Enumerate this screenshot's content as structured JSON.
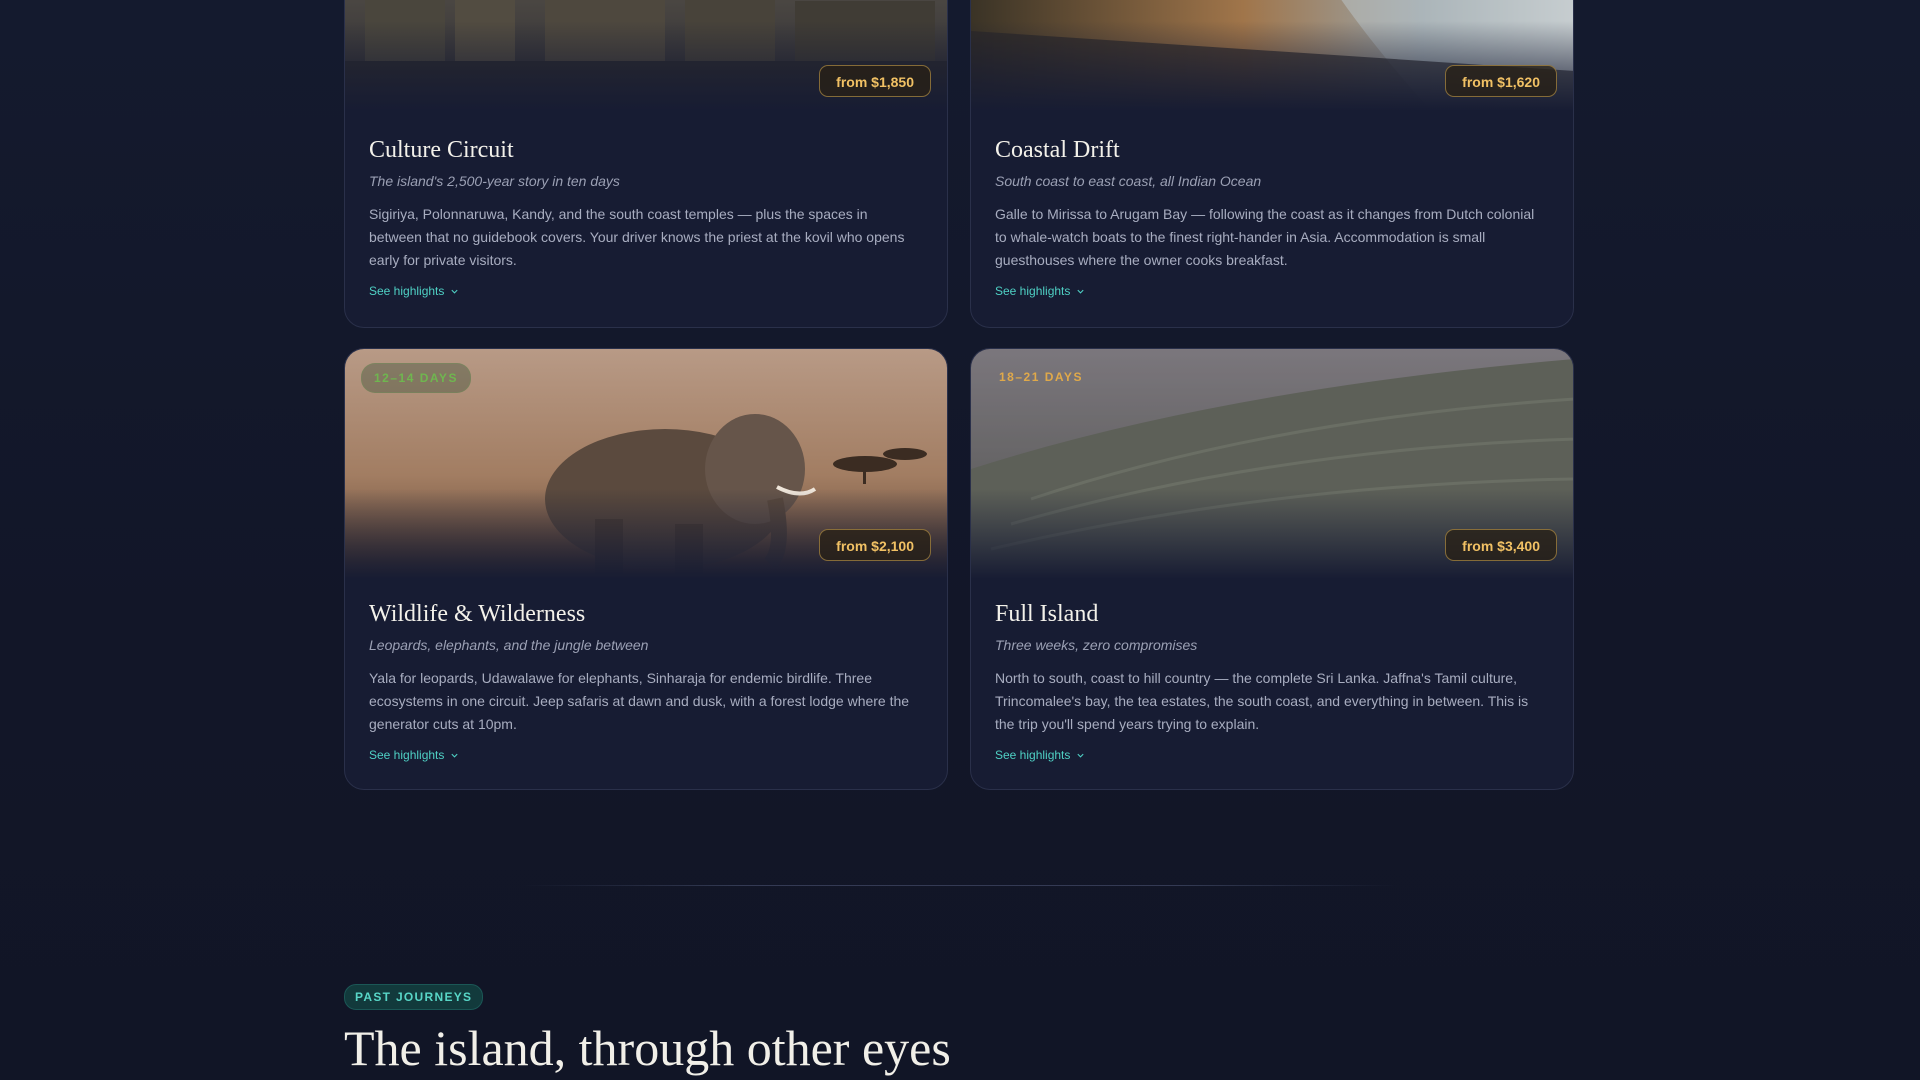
{
  "tours": [
    {
      "title": "Culture Circuit",
      "subtitle": "The island's 2,500-year story in ten days",
      "description": "Sigiriya, Polonnaruwa, Kandy, and the south coast temples — plus the spaces in between that no guidebook covers. Your driver knows the priest at the kovil who opens early for private visitors.",
      "price": "from $1,850",
      "highlights_label": "See highlights",
      "image": "temple-ruins-photo"
    },
    {
      "title": "Coastal Drift",
      "subtitle": "South coast to east coast, all Indian Ocean",
      "description": "Galle to Mirissa to Arugam Bay — following the coast as it changes from Dutch colonial to whale-watch boats to the finest right-hander in Asia. Accommodation is small guesthouses where the owner cooks breakfast.",
      "price": "from $1,620",
      "highlights_label": "See highlights",
      "image": "beach-coast-photo"
    },
    {
      "title": "Wildlife & Wilderness",
      "subtitle": "Leopards, elephants, and the jungle between",
      "description": "Yala for leopards, Udawalawe for elephants, Sinharaja for endemic birdlife. Three ecosystems in one circuit. Jeep safaris at dawn and dusk, with a forest lodge where the generator cuts at 10pm.",
      "price": "from $2,100",
      "duration": "12–14 DAYS",
      "highlights_label": "See highlights",
      "image": "elephant-savanna-photo"
    },
    {
      "title": "Full Island",
      "subtitle": "Three weeks, zero compromises",
      "description": "North to south, coast to hill country — the complete Sri Lanka. Jaffna's Tamil culture, Trincomalee's bay, the tea estates, the south coast, and everything in between. This is the trip you'll spend years trying to explain.",
      "price": "from $3,400",
      "duration": "18–21 DAYS",
      "highlights_label": "See highlights",
      "image": "tea-hills-mist-photo"
    }
  ],
  "past_journeys": {
    "eyebrow": "PAST JOURNEYS",
    "title": "The island, through other eyes"
  },
  "colors": {
    "background": "#121628",
    "card": "#171c33",
    "accent_teal": "#4fd1c5",
    "price_gold": "#f1c164"
  }
}
